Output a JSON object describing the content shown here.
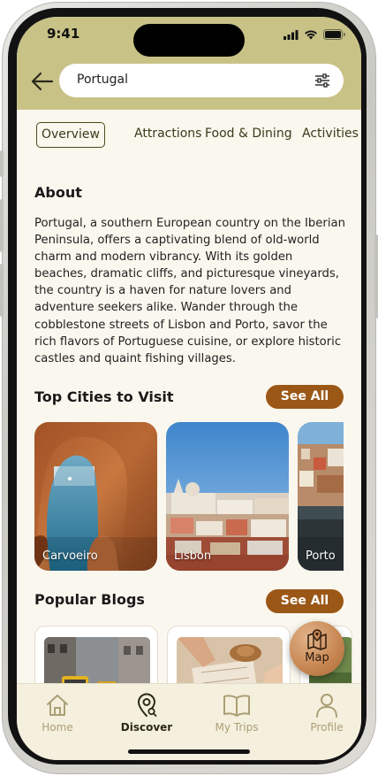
{
  "status_bar": {
    "time": "9:41"
  },
  "search": {
    "value": "Portugal"
  },
  "tabs": [
    {
      "label": "Overview",
      "active": true
    },
    {
      "label": "Attractions",
      "active": false
    },
    {
      "label": "Food & Dining",
      "active": false
    },
    {
      "label": "Activities",
      "active": false
    }
  ],
  "about": {
    "title": "About",
    "text": "Portugal, a southern European country on the Iberian Peninsula, offers a captivating blend of old-world charm and modern vibrancy. With its golden beaches, dramatic cliffs, and picturesque vineyards, the country is a haven for nature lovers and adventure seekers alike. Wander through the cobblestone streets of Lisbon and Porto, savor the rich flavors of Portuguese cuisine, or explore historic castles and quaint fishing villages."
  },
  "top_cities": {
    "title": "Top Cities to Visit",
    "see_all_label": "See All",
    "cities": [
      {
        "name": "Carvoeiro"
      },
      {
        "name": "Lisbon"
      },
      {
        "name": "Porto"
      }
    ]
  },
  "popular_blogs": {
    "title": "Popular Blogs",
    "see_all_label": "See All"
  },
  "map_button": {
    "label": "Map"
  },
  "bottom_nav": [
    {
      "label": "Home",
      "icon": "home-icon",
      "active": false
    },
    {
      "label": "Discover",
      "icon": "discover-icon",
      "active": true
    },
    {
      "label": "My Trips",
      "icon": "book-icon",
      "active": false
    },
    {
      "label": "Profile",
      "icon": "person-icon",
      "active": false
    }
  ],
  "colors": {
    "header_bg": "#c8c287",
    "screen_bg": "#faf7ee",
    "accent_brown": "#9b5716",
    "active_tab_border": "#4a4a1e",
    "nav_inactive": "#aa9f75"
  }
}
